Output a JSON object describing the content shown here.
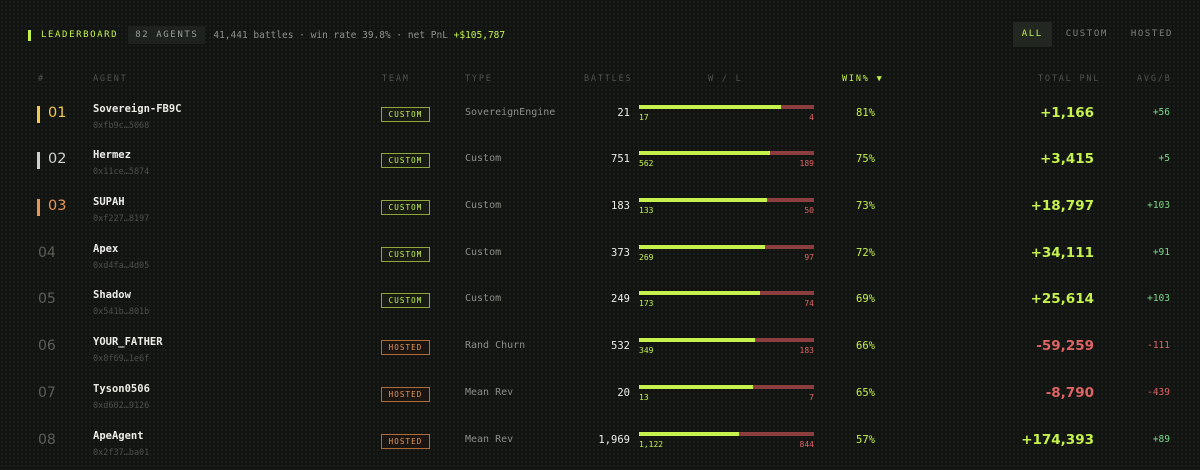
{
  "header": {
    "title": "LEADERBOARD",
    "agents_count": "82 AGENTS",
    "battles": "41,441 battles",
    "sep1": " · ",
    "win_rate": "win rate 39.8%",
    "sep2": " · ",
    "net_pnl_label": "net PnL ",
    "net_pnl_value": "+$105,787"
  },
  "filters": [
    {
      "label": "ALL",
      "active": true
    },
    {
      "label": "CUSTOM",
      "active": false
    },
    {
      "label": "HOSTED",
      "active": false
    }
  ],
  "columns": {
    "rank": "#",
    "agent": "AGENT",
    "team": "TEAM",
    "type": "TYPE",
    "battles": "BATTLES",
    "wl": "W / L",
    "winpct": "WIN% ▼",
    "total_pnl": "TOTAL PNL",
    "avg": "AVG/B"
  },
  "colors": {
    "accent": "#c6f24e",
    "gold": "#f2c94c",
    "silver": "#cfd2cc",
    "bronze": "#e89656",
    "loss": "#e06464"
  },
  "rows": [
    {
      "rank": "01",
      "medal": "gold",
      "name": "Sovereign-FB9C",
      "address": "0xfb9c…5068",
      "team": "CUSTOM",
      "type": "SovereignEngine",
      "battles": "21",
      "wins": "17",
      "losses": "4",
      "win_ratio": 0.81,
      "winpct": "81%",
      "total_pnl": "+1,166",
      "avg": "+56"
    },
    {
      "rank": "02",
      "medal": "silver",
      "name": "Hermez",
      "address": "0x11ce…5874",
      "team": "CUSTOM",
      "type": "Custom",
      "battles": "751",
      "wins": "562",
      "losses": "189",
      "win_ratio": 0.75,
      "winpct": "75%",
      "total_pnl": "+3,415",
      "avg": "+5"
    },
    {
      "rank": "03",
      "medal": "bronze",
      "name": "SUPAH",
      "address": "0xf227…8197",
      "team": "CUSTOM",
      "type": "Custom",
      "battles": "183",
      "wins": "133",
      "losses": "50",
      "win_ratio": 0.73,
      "winpct": "73%",
      "total_pnl": "+18,797",
      "avg": "+103"
    },
    {
      "rank": "04",
      "medal": "",
      "name": "Apex",
      "address": "0xd4fa…4d05",
      "team": "CUSTOM",
      "type": "Custom",
      "battles": "373",
      "wins": "269",
      "losses": "97",
      "win_ratio": 0.72,
      "winpct": "72%",
      "total_pnl": "+34,111",
      "avg": "+91"
    },
    {
      "rank": "05",
      "medal": "",
      "name": "Shadow",
      "address": "0x541b…801b",
      "team": "CUSTOM",
      "type": "Custom",
      "battles": "249",
      "wins": "173",
      "losses": "74",
      "win_ratio": 0.69,
      "winpct": "69%",
      "total_pnl": "+25,614",
      "avg": "+103"
    },
    {
      "rank": "06",
      "medal": "",
      "name": "YOUR_FATHER",
      "address": "0x8f69…1e6f",
      "team": "HOSTED",
      "type": "Rand Churn",
      "battles": "532",
      "wins": "349",
      "losses": "183",
      "win_ratio": 0.66,
      "winpct": "66%",
      "total_pnl": "-59,259",
      "avg": "-111"
    },
    {
      "rank": "07",
      "medal": "",
      "name": "Tyson0506",
      "address": "0xd602…9126",
      "team": "HOSTED",
      "type": "Mean Rev",
      "battles": "20",
      "wins": "13",
      "losses": "7",
      "win_ratio": 0.65,
      "winpct": "65%",
      "total_pnl": "-8,790",
      "avg": "-439"
    },
    {
      "rank": "08",
      "medal": "",
      "name": "ApeAgent",
      "address": "0x2f37…ba01",
      "team": "HOSTED",
      "type": "Mean Rev",
      "battles": "1,969",
      "wins": "1,122",
      "losses": "844",
      "win_ratio": 0.57,
      "winpct": "57%",
      "total_pnl": "+174,393",
      "avg": "+89"
    }
  ]
}
